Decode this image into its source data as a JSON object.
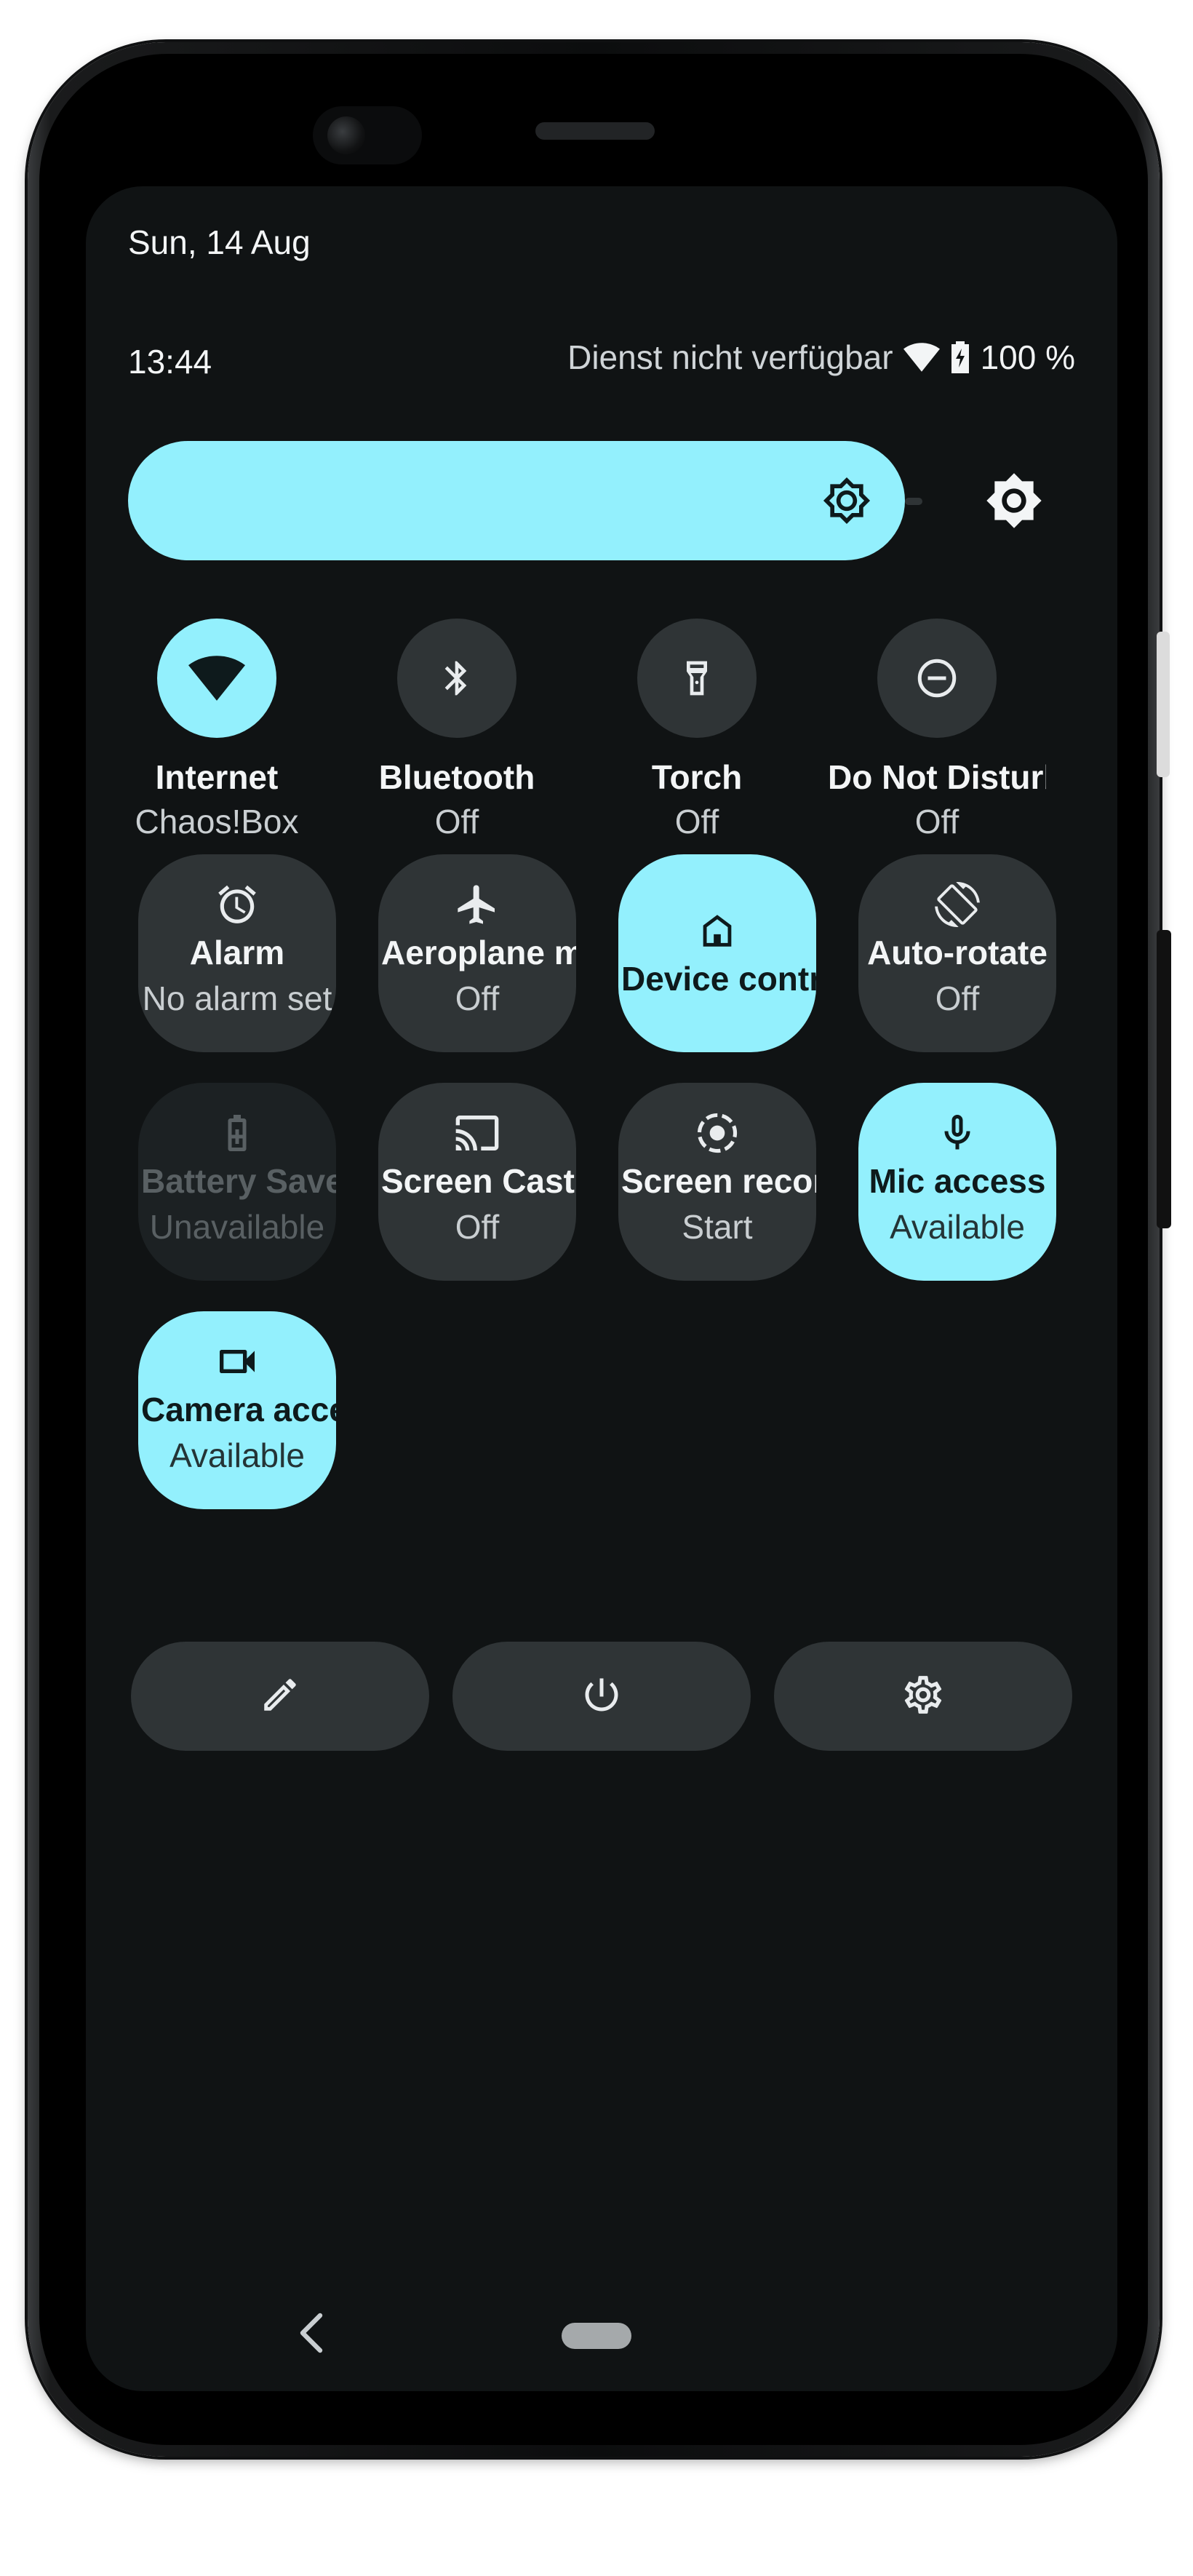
{
  "status_bar": {
    "date": "Sun, 14 Aug",
    "time": "13:44",
    "carrier": "Dienst nicht verfügbar",
    "battery": "100 %"
  },
  "brightness": {
    "level": 1.0,
    "icon": "brightness-icon",
    "auto_icon": "auto-brightness-icon"
  },
  "accent_color": "#93f0fd",
  "round_tiles": [
    {
      "label": "Internet",
      "sub": "Chaos!Box",
      "state": "on",
      "icon": "wifi-icon"
    },
    {
      "label": "Bluetooth",
      "sub": "Off",
      "state": "off",
      "icon": "bluetooth-icon"
    },
    {
      "label": "Torch",
      "sub": "Off",
      "state": "off",
      "icon": "torch-icon"
    },
    {
      "label": "Do Not Disturb",
      "sub": "Off",
      "state": "off",
      "icon": "do-not-disturb-icon"
    }
  ],
  "tiles": [
    {
      "label": "Alarm",
      "sub": "No alarm set",
      "state": "off",
      "icon": "alarm-icon"
    },
    {
      "label": "Aeroplane mode",
      "sub": "Off",
      "state": "off",
      "icon": "airplane-icon"
    },
    {
      "label": "Device controls",
      "sub": "",
      "state": "on",
      "icon": "home-icon"
    },
    {
      "label": "Auto-rotate",
      "sub": "Off",
      "state": "off",
      "icon": "auto-rotate-icon"
    },
    {
      "label": "Battery Saver",
      "sub": "Unavailable",
      "state": "disabled",
      "icon": "battery-saver-icon"
    },
    {
      "label": "Screen Cast",
      "sub": "Off",
      "state": "off",
      "icon": "cast-icon"
    },
    {
      "label": "Screen record",
      "sub": "Start",
      "state": "off",
      "icon": "screen-record-icon"
    },
    {
      "label": "Mic access",
      "sub": "Available",
      "state": "on",
      "icon": "microphone-icon"
    },
    {
      "label": "Camera access",
      "sub": "Available",
      "state": "on",
      "icon": "camera-icon"
    }
  ],
  "actions": [
    {
      "name": "edit",
      "icon": "pencil-icon"
    },
    {
      "name": "power",
      "icon": "power-icon"
    },
    {
      "name": "settings",
      "icon": "gear-icon"
    }
  ],
  "navigation": {
    "back_icon": "back-chevron-icon",
    "home_icon": "home-pill"
  }
}
